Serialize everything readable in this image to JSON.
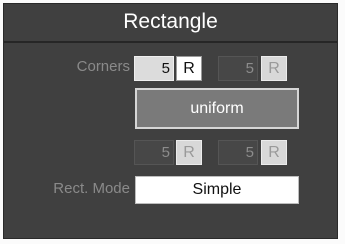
{
  "panel": {
    "title": "Rectangle",
    "corners_label": "Corners",
    "corners": [
      {
        "value": "5",
        "r_label": "R"
      },
      {
        "value": "5",
        "r_label": "R"
      },
      {
        "value": "5",
        "r_label": "R"
      },
      {
        "value": "5",
        "r_label": "R"
      }
    ],
    "uniform_label": "uniform",
    "rect_mode_label": "Rect. Mode",
    "rect_mode_value": "Simple"
  }
}
